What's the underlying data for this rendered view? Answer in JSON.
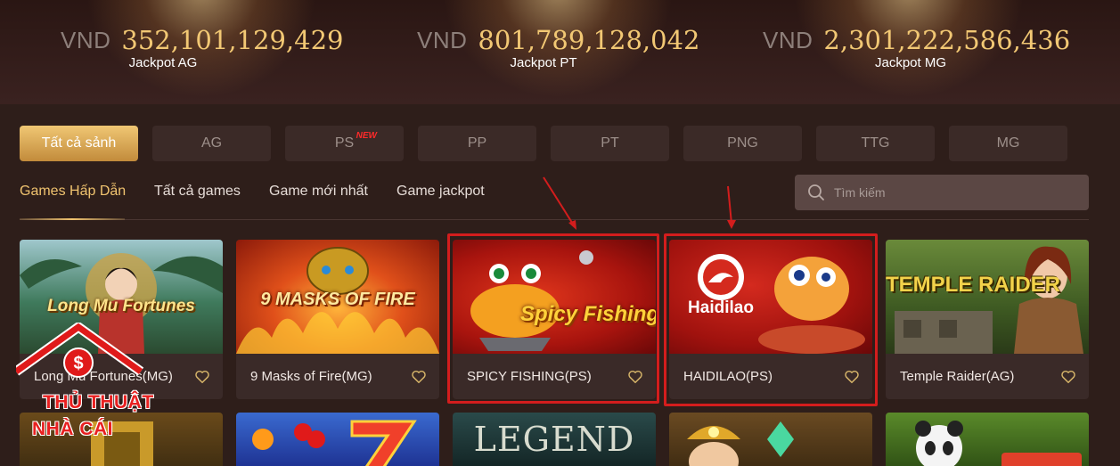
{
  "jackpots": [
    {
      "currency": "VND",
      "value": "352,101,129,429",
      "label": "Jackpot AG"
    },
    {
      "currency": "VND",
      "value": "801,789,128,042",
      "label": "Jackpot PT"
    },
    {
      "currency": "VND",
      "value": "2,301,222,586,436",
      "label": "Jackpot MG"
    }
  ],
  "providers": [
    {
      "label": "Tất cả sảnh",
      "active": true
    },
    {
      "label": "AG"
    },
    {
      "label": "PS",
      "badge": "NEW"
    },
    {
      "label": "PP"
    },
    {
      "label": "PT"
    },
    {
      "label": "PNG"
    },
    {
      "label": "TTG"
    },
    {
      "label": "MG"
    }
  ],
  "categories": [
    {
      "label": "Games Hấp Dẫn",
      "active": true
    },
    {
      "label": "Tất cả games"
    },
    {
      "label": "Game mới nhất"
    },
    {
      "label": "Game jackpot"
    }
  ],
  "search": {
    "placeholder": "Tìm kiếm",
    "icon": "search-icon"
  },
  "games": [
    {
      "name": "Long Mu Fortunes(MG)",
      "thumb_title": "Long Mu Fortunes"
    },
    {
      "name": "9 Masks of Fire(MG)",
      "thumb_title": "9 MASKS OF FIRE"
    },
    {
      "name": "SPICY FISHING(PS)",
      "thumb_title": "Spicy Fishing",
      "highlighted": true
    },
    {
      "name": "HAIDILAO(PS)",
      "thumb_title": "Haidilao",
      "highlighted": true
    },
    {
      "name": "Temple Raider(AG)",
      "thumb_title": "TEMPLE RAIDER"
    }
  ],
  "row2_titles": [
    "",
    "",
    "LEGEND",
    "",
    ""
  ],
  "watermark": {
    "line1": "THỦ THUẬT",
    "line2": "NHÀ CÁI"
  },
  "colors": {
    "accent": "#f0c36f",
    "highlight": "#d31d1d",
    "background": "#2e1e1a"
  }
}
